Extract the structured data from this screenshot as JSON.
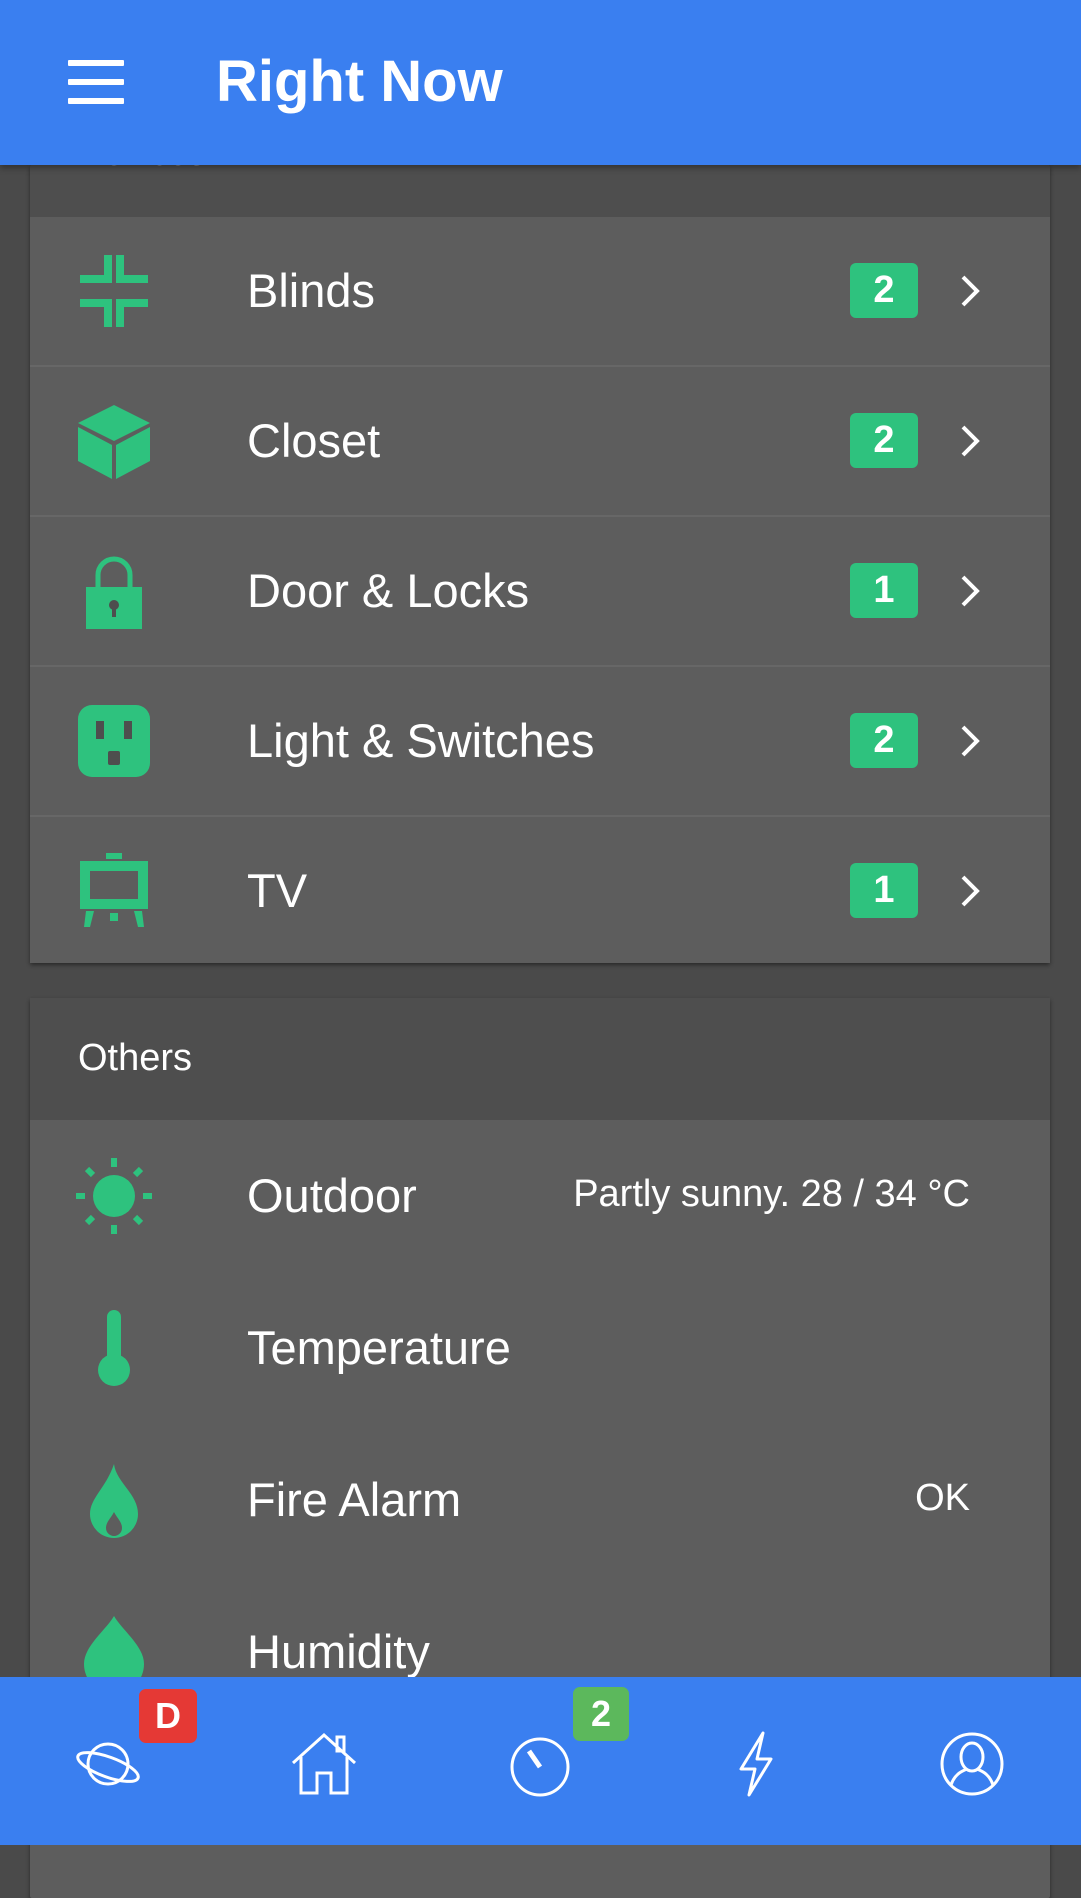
{
  "app_bar": {
    "title": "Right Now",
    "menu_icon": "hamburger-menu-icon"
  },
  "devices_section": {
    "heading": "Devices"
  },
  "devices": [
    {
      "label": "Blinds",
      "count": "2",
      "icon": "blinds-icon"
    },
    {
      "label": "Closet",
      "count": "2",
      "icon": "cube-icon"
    },
    {
      "label": "Door & Locks",
      "count": "1",
      "icon": "padlock-icon"
    },
    {
      "label": "Light & Switches",
      "count": "2",
      "icon": "power-outlet-icon"
    },
    {
      "label": "TV",
      "count": "1",
      "icon": "tv-icon"
    }
  ],
  "others_section": {
    "heading": "Others"
  },
  "others": [
    {
      "label": "Outdoor",
      "value": "Partly sunny. 28 / 34 °C",
      "icon": "sun-icon"
    },
    {
      "label": "Temperature",
      "value": "",
      "icon": "thermometer-icon"
    },
    {
      "label": "Fire Alarm",
      "value": "OK",
      "icon": "flame-icon"
    },
    {
      "label": "Humidity",
      "value": "",
      "icon": "droplet-icon"
    }
  ],
  "bottom_nav": [
    {
      "icon": "planet-icon",
      "badge": "D",
      "badge_color": "#e53935"
    },
    {
      "icon": "home-icon",
      "badge": ""
    },
    {
      "icon": "timer-icon",
      "badge": "2",
      "badge_color": "#5cb85c"
    },
    {
      "icon": "lightning-icon",
      "badge": ""
    },
    {
      "icon": "user-icon",
      "badge": ""
    }
  ],
  "colors": {
    "primary": "#3a7ff0",
    "accent": "#2ec27e",
    "card": "#5d5d5d",
    "header": "#4e4e4e",
    "background": "#4a4a4a"
  }
}
